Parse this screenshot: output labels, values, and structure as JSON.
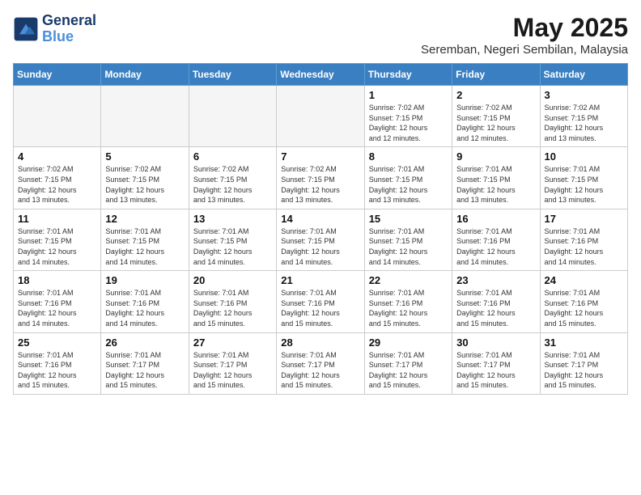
{
  "header": {
    "logo_line1": "General",
    "logo_line2": "Blue",
    "month": "May 2025",
    "location": "Seremban, Negeri Sembilan, Malaysia"
  },
  "weekdays": [
    "Sunday",
    "Monday",
    "Tuesday",
    "Wednesday",
    "Thursday",
    "Friday",
    "Saturday"
  ],
  "weeks": [
    [
      {
        "day": "",
        "info": ""
      },
      {
        "day": "",
        "info": ""
      },
      {
        "day": "",
        "info": ""
      },
      {
        "day": "",
        "info": ""
      },
      {
        "day": "1",
        "info": "Sunrise: 7:02 AM\nSunset: 7:15 PM\nDaylight: 12 hours\nand 12 minutes."
      },
      {
        "day": "2",
        "info": "Sunrise: 7:02 AM\nSunset: 7:15 PM\nDaylight: 12 hours\nand 12 minutes."
      },
      {
        "day": "3",
        "info": "Sunrise: 7:02 AM\nSunset: 7:15 PM\nDaylight: 12 hours\nand 13 minutes."
      }
    ],
    [
      {
        "day": "4",
        "info": "Sunrise: 7:02 AM\nSunset: 7:15 PM\nDaylight: 12 hours\nand 13 minutes."
      },
      {
        "day": "5",
        "info": "Sunrise: 7:02 AM\nSunset: 7:15 PM\nDaylight: 12 hours\nand 13 minutes."
      },
      {
        "day": "6",
        "info": "Sunrise: 7:02 AM\nSunset: 7:15 PM\nDaylight: 12 hours\nand 13 minutes."
      },
      {
        "day": "7",
        "info": "Sunrise: 7:02 AM\nSunset: 7:15 PM\nDaylight: 12 hours\nand 13 minutes."
      },
      {
        "day": "8",
        "info": "Sunrise: 7:01 AM\nSunset: 7:15 PM\nDaylight: 12 hours\nand 13 minutes."
      },
      {
        "day": "9",
        "info": "Sunrise: 7:01 AM\nSunset: 7:15 PM\nDaylight: 12 hours\nand 13 minutes."
      },
      {
        "day": "10",
        "info": "Sunrise: 7:01 AM\nSunset: 7:15 PM\nDaylight: 12 hours\nand 13 minutes."
      }
    ],
    [
      {
        "day": "11",
        "info": "Sunrise: 7:01 AM\nSunset: 7:15 PM\nDaylight: 12 hours\nand 14 minutes."
      },
      {
        "day": "12",
        "info": "Sunrise: 7:01 AM\nSunset: 7:15 PM\nDaylight: 12 hours\nand 14 minutes."
      },
      {
        "day": "13",
        "info": "Sunrise: 7:01 AM\nSunset: 7:15 PM\nDaylight: 12 hours\nand 14 minutes."
      },
      {
        "day": "14",
        "info": "Sunrise: 7:01 AM\nSunset: 7:15 PM\nDaylight: 12 hours\nand 14 minutes."
      },
      {
        "day": "15",
        "info": "Sunrise: 7:01 AM\nSunset: 7:15 PM\nDaylight: 12 hours\nand 14 minutes."
      },
      {
        "day": "16",
        "info": "Sunrise: 7:01 AM\nSunset: 7:16 PM\nDaylight: 12 hours\nand 14 minutes."
      },
      {
        "day": "17",
        "info": "Sunrise: 7:01 AM\nSunset: 7:16 PM\nDaylight: 12 hours\nand 14 minutes."
      }
    ],
    [
      {
        "day": "18",
        "info": "Sunrise: 7:01 AM\nSunset: 7:16 PM\nDaylight: 12 hours\nand 14 minutes."
      },
      {
        "day": "19",
        "info": "Sunrise: 7:01 AM\nSunset: 7:16 PM\nDaylight: 12 hours\nand 14 minutes."
      },
      {
        "day": "20",
        "info": "Sunrise: 7:01 AM\nSunset: 7:16 PM\nDaylight: 12 hours\nand 15 minutes."
      },
      {
        "day": "21",
        "info": "Sunrise: 7:01 AM\nSunset: 7:16 PM\nDaylight: 12 hours\nand 15 minutes."
      },
      {
        "day": "22",
        "info": "Sunrise: 7:01 AM\nSunset: 7:16 PM\nDaylight: 12 hours\nand 15 minutes."
      },
      {
        "day": "23",
        "info": "Sunrise: 7:01 AM\nSunset: 7:16 PM\nDaylight: 12 hours\nand 15 minutes."
      },
      {
        "day": "24",
        "info": "Sunrise: 7:01 AM\nSunset: 7:16 PM\nDaylight: 12 hours\nand 15 minutes."
      }
    ],
    [
      {
        "day": "25",
        "info": "Sunrise: 7:01 AM\nSunset: 7:16 PM\nDaylight: 12 hours\nand 15 minutes."
      },
      {
        "day": "26",
        "info": "Sunrise: 7:01 AM\nSunset: 7:17 PM\nDaylight: 12 hours\nand 15 minutes."
      },
      {
        "day": "27",
        "info": "Sunrise: 7:01 AM\nSunset: 7:17 PM\nDaylight: 12 hours\nand 15 minutes."
      },
      {
        "day": "28",
        "info": "Sunrise: 7:01 AM\nSunset: 7:17 PM\nDaylight: 12 hours\nand 15 minutes."
      },
      {
        "day": "29",
        "info": "Sunrise: 7:01 AM\nSunset: 7:17 PM\nDaylight: 12 hours\nand 15 minutes."
      },
      {
        "day": "30",
        "info": "Sunrise: 7:01 AM\nSunset: 7:17 PM\nDaylight: 12 hours\nand 15 minutes."
      },
      {
        "day": "31",
        "info": "Sunrise: 7:01 AM\nSunset: 7:17 PM\nDaylight: 12 hours\nand 15 minutes."
      }
    ]
  ]
}
